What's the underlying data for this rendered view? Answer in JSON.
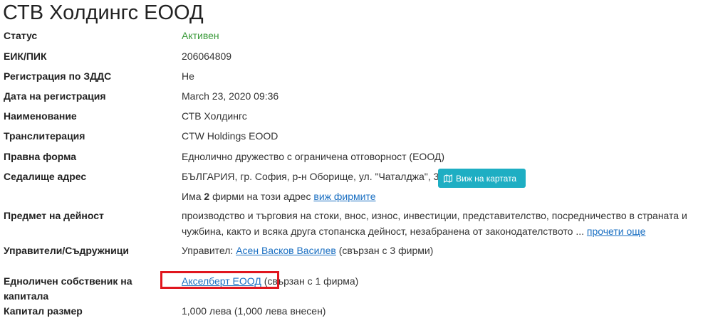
{
  "company": {
    "title": "СТВ Холдингс ЕООД"
  },
  "fields": {
    "status": {
      "label": "Статус",
      "value": "Активен"
    },
    "eik": {
      "label": "ЕИК/ПИК",
      "value": "206064809"
    },
    "vat": {
      "label": "Регистрация по ЗДДС",
      "value": "Не"
    },
    "reg_date": {
      "label": "Дата на регистрация",
      "value": "March 23, 2020 09:36"
    },
    "name": {
      "label": "Наименование",
      "value": "СТВ Холдингс"
    },
    "translit": {
      "label": "Транслитерация",
      "value": "CTW Holdings EOOD"
    },
    "legal_form": {
      "label": "Правна форма",
      "value": "Еднолично дружество с ограничена отговорност (ЕООД)"
    },
    "address": {
      "label": "Седалище адрес",
      "value": "БЪЛГАРИЯ, гр. София, р-н Оборище, ул. \"Чаталджа\", 3",
      "map_button": "Виж на картата",
      "same_address_prefix": "Има",
      "same_address_count": "2",
      "same_address_suffix": "фирми на този адрес",
      "same_address_link": "виж фирмите"
    },
    "activity": {
      "label": "Предмет на дейност",
      "line1": "производство и търговия на стоки, внос, износ, инвестиции, представителство, посредничество в страната и",
      "line2": "чужбина, както и всяка друга стопанска дейност, незабранена от законодателството ...",
      "read_more": "прочети още"
    },
    "managers": {
      "label": "Управители/Съдружници",
      "prefix": "Управител:",
      "person": "Асен Васков Василев",
      "suffix": "(свързан с 3 фирми)"
    },
    "owner": {
      "label_line1": "Едноличен собственик на",
      "label_line2": "капитала",
      "company_link": "Акселберт ЕООД",
      "suffix": "(свързан с 1 фирма)"
    },
    "capital": {
      "label": "Капитал размер",
      "value": "1,000 лева (1,000 лева внесен)"
    }
  },
  "colors": {
    "status_green": "#3a9a3a",
    "link_blue": "#1a6fc2",
    "map_button_bg": "#1eaec3",
    "highlight_red": "#e0161e"
  },
  "icons": {
    "map_button_icon": "map-icon"
  }
}
